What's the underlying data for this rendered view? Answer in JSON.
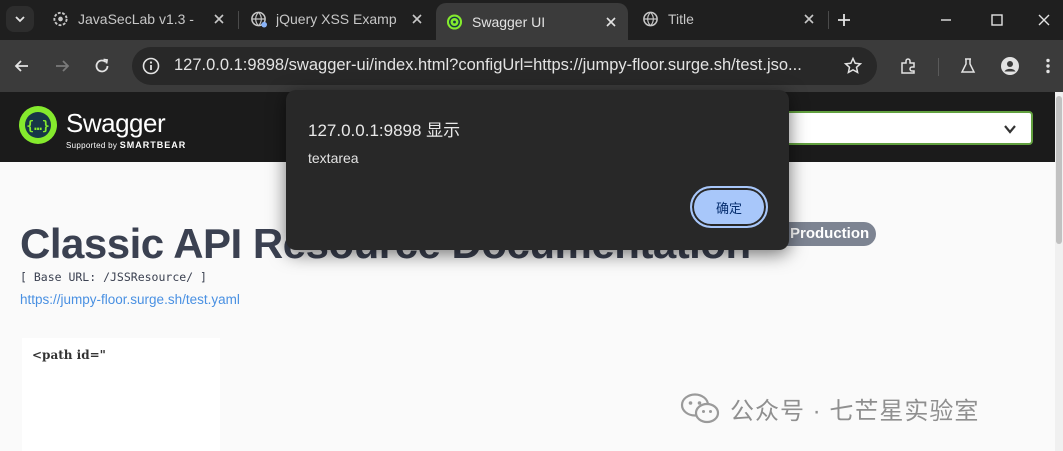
{
  "tabs": [
    {
      "title": "JavaSecLab v1.3 -",
      "icon": "gear-icon",
      "active": false
    },
    {
      "title": "jQuery XSS Examp",
      "icon": "globe-icon",
      "active": false
    },
    {
      "title": "Swagger UI",
      "icon": "swagger-icon",
      "active": true
    },
    {
      "title": "Title",
      "icon": "globe-icon",
      "active": false
    }
  ],
  "toolbar": {
    "url": "127.0.0.1:9898/swagger-ui/index.html?configUrl=https://jumpy-floor.surge.sh/test.jso..."
  },
  "swagger": {
    "brand": "Swagger",
    "supported_by": "Supported by",
    "smartbear": "SMARTBEAR",
    "doc_title": "Classic API Resource Documentation",
    "version_badge": "Production",
    "base_url": "[ Base URL: /JSSResource/ ]",
    "spec_link": "https://jumpy-floor.surge.sh/test.yaml",
    "description_snippet": "<path id=\""
  },
  "dialog": {
    "title": "127.0.0.1:9898 显示",
    "message": "textarea",
    "ok_label": "确定"
  },
  "watermark": {
    "text": "公众号 · 七芒星实验室"
  },
  "colors": {
    "tab_strip": "#1f1f1f",
    "toolbar": "#3b3b3b",
    "swagger_green": "#62a03f",
    "dialog_bg": "#282828",
    "ok_button": "#a8c7fa"
  }
}
